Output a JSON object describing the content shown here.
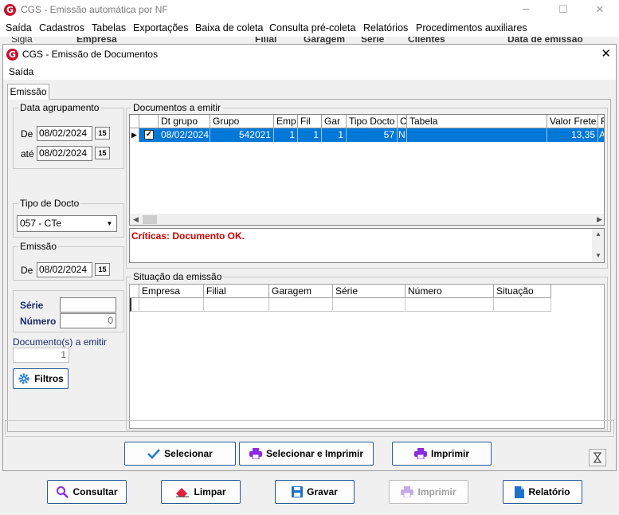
{
  "main_window": {
    "title": "CGS - Emissão automática por NF",
    "logo": "G",
    "minimize": "─",
    "maximize": "☐",
    "close": "✕",
    "menu": [
      "Saída",
      "Cadastros",
      "Tabelas",
      "Exportações",
      "Baixa de coleta",
      "Consulta pré-coleta",
      "Relatórios",
      "Procedimentos auxiliares"
    ],
    "background_labels": [
      "Sigla",
      "Empresa",
      "Filial",
      "Garagem",
      "Série",
      "Clientes",
      "Data de emissão"
    ],
    "buttons": {
      "consultar": "Consultar",
      "limpar": "Limpar",
      "gravar": "Gravar",
      "imprimir": "Imprimir",
      "relatorio": "Relatório"
    }
  },
  "dialog": {
    "title": "CGS - Emissão de Documentos",
    "logo": "G",
    "close": "✕",
    "menu": [
      "Saída"
    ],
    "tab": "Emissão",
    "data_agrupamento": {
      "label": "Data agrupamento",
      "de_label": "De",
      "de_value": "08/02/2024",
      "ate_label": "até",
      "ate_value": "08/02/2024",
      "calendar_glyph": "15"
    },
    "tipo_docto": {
      "label": "Tipo de Docto",
      "selected": "057 - CTe"
    },
    "emissao": {
      "label": "Emissão",
      "de_label": "De",
      "de_value": "08/02/2024",
      "calendar_glyph": "15"
    },
    "serie_label": "Série",
    "serie_value": "",
    "numero_label": "Número",
    "numero_value": "0",
    "docs_emitir_label": "Documento(s) a emitir",
    "docs_emitir_value": "1",
    "filtros_label": "Filtros",
    "documentos": {
      "label": "Documentos a emitir",
      "columns": [
        "",
        "Dt grupo",
        "Grupo",
        "Emp",
        "Fil",
        "Gar",
        "Tipo Docto",
        "C",
        "Tabela",
        "Valor Frete",
        "R"
      ],
      "rows": [
        {
          "checked": true,
          "dt_grupo": "08/02/2024",
          "grupo": "542021",
          "emp": "1",
          "fil": "1",
          "gar": "1",
          "tipo_docto": "57",
          "c": "N",
          "tabela": "",
          "valor_frete": "13,35",
          "r": "At"
        }
      ]
    },
    "criticas": "Críticas: Documento OK.",
    "situacao": {
      "label": "Situação da emissão",
      "columns": [
        "Empresa",
        "Filial",
        "Garagem",
        "Série",
        "Número",
        "Situação"
      ]
    },
    "buttons": {
      "selecionar": "Selecionar",
      "selecionar_imprimir": "Selecionar e Imprimir",
      "imprimir": "Imprimir"
    }
  },
  "colors": {
    "selection": "#0078d7",
    "critica_text": "#cc0000",
    "brand": "#c8102e",
    "label_blue": "#1a2a6c"
  }
}
